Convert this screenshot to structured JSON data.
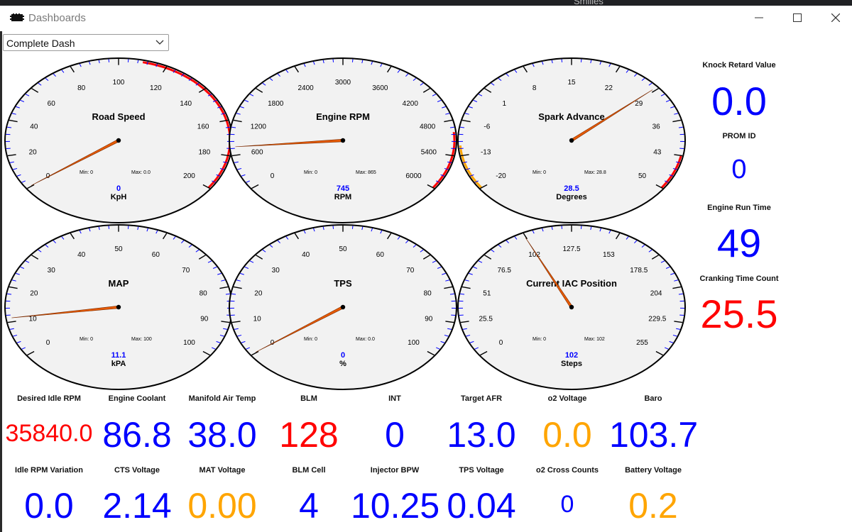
{
  "window": {
    "title": "Dashboards",
    "background_tab_text": "Smilies"
  },
  "dashboard_select": {
    "value": "Complete Dash"
  },
  "colors": {
    "blue": "#0000ff",
    "red": "#ff0000",
    "orange": "#ffa500",
    "needle": "#e65a00",
    "face": "#f2f2f2",
    "warning": "#ff0000",
    "caution": "#ffa500"
  },
  "gauges": [
    {
      "title": "Road Speed",
      "unit": "KpH",
      "value": 0,
      "value_text": "0",
      "min_label": "Min: 0",
      "max_label": "Max: 0.0",
      "range": [
        0,
        200
      ],
      "ticks": [
        "0",
        "20",
        "40",
        "60",
        "80",
        "100",
        "120",
        "140",
        "160",
        "180",
        "200"
      ],
      "red_from": 110,
      "caution": null
    },
    {
      "title": "Engine RPM",
      "unit": "RPM",
      "value": 745,
      "value_text": "745",
      "min_label": "Min: 0",
      "max_label": "Max: 865",
      "range": [
        0,
        6000
      ],
      "ticks": [
        "0",
        "600",
        "1200",
        "1800",
        "2400",
        "3000",
        "3600",
        "4200",
        "4800",
        "5400",
        "6000"
      ],
      "red_from": 5000,
      "caution": null
    },
    {
      "title": "Spark Advance",
      "unit": "Degrees",
      "value": 28.5,
      "value_text": "28.5",
      "min_label": "Min: 0",
      "max_label": "Max: 28.8",
      "range": [
        -20,
        50
      ],
      "ticks": [
        "-20",
        "-13",
        "-6",
        "1",
        "8",
        "15",
        "22",
        "29",
        "36",
        "43",
        "50"
      ],
      "red_from": 43,
      "caution": [
        -20,
        -11
      ]
    },
    {
      "title": "MAP",
      "unit": "kPA",
      "value": 11.1,
      "value_text": "11.1",
      "min_label": "Min: 0",
      "max_label": "Max: 100",
      "range": [
        0,
        100
      ],
      "ticks": [
        "0",
        "10",
        "20",
        "30",
        "40",
        "50",
        "60",
        "70",
        "80",
        "90",
        "100"
      ],
      "red_from": null,
      "caution": null
    },
    {
      "title": "TPS",
      "unit": "%",
      "value": 0,
      "value_text": "0",
      "min_label": "Min: 0",
      "max_label": "Max: 0.0",
      "range": [
        0,
        100
      ],
      "ticks": [
        "0",
        "10",
        "20",
        "30",
        "40",
        "50",
        "60",
        "70",
        "80",
        "90",
        "100"
      ],
      "red_from": null,
      "caution": null
    },
    {
      "title": "Current IAC Position",
      "unit": "Steps",
      "value": 102,
      "value_text": "102",
      "min_label": "Min: 0",
      "max_label": "Max: 102",
      "range": [
        0,
        255
      ],
      "ticks": [
        "0",
        "25.5",
        "51",
        "76.5",
        "102",
        "127.5",
        "153",
        "178.5",
        "204",
        "229.5",
        "255"
      ],
      "red_from": null,
      "caution": null
    }
  ],
  "side_readouts": [
    {
      "label": "Knock Retard Value",
      "value": "0.0",
      "color": "#0000ff"
    },
    {
      "label": "PROM ID",
      "value": "0",
      "color": "#0000ff"
    },
    {
      "label": "Engine Run Time",
      "value": "49",
      "color": "#0000ff"
    },
    {
      "label": "Cranking Time Count",
      "value": "25.5",
      "color": "#ff0000"
    }
  ],
  "readouts_row1": [
    {
      "label": "Desired Idle RPM",
      "value": "35840.0",
      "color": "#ff0000"
    },
    {
      "label": "Engine Coolant",
      "value": "86.8",
      "color": "#0000ff"
    },
    {
      "label": "Manifold Air Temp",
      "value": "38.0",
      "color": "#0000ff"
    },
    {
      "label": "BLM",
      "value": "128",
      "color": "#ff0000"
    },
    {
      "label": "INT",
      "value": "0",
      "color": "#0000ff"
    },
    {
      "label": "Target AFR",
      "value": "13.0",
      "color": "#0000ff"
    },
    {
      "label": "o2 Voltage",
      "value": "0.0",
      "color": "#ffa500"
    },
    {
      "label": "Baro",
      "value": "103.7",
      "color": "#0000ff"
    }
  ],
  "readouts_row2": [
    {
      "label": "Idle RPM Variation",
      "value": "0.0",
      "color": "#0000ff"
    },
    {
      "label": "CTS Voltage",
      "value": "2.14",
      "color": "#0000ff"
    },
    {
      "label": "MAT Voltage",
      "value": "0.00",
      "color": "#ffa500"
    },
    {
      "label": "BLM Cell",
      "value": "4",
      "color": "#0000ff"
    },
    {
      "label": "Injector BPW",
      "value": "10.25",
      "color": "#0000ff"
    },
    {
      "label": "TPS Voltage",
      "value": "0.04",
      "color": "#0000ff"
    },
    {
      "label": "o2 Cross Counts",
      "value": "0",
      "color": "#0000ff"
    },
    {
      "label": "Battery Voltage",
      "value": "0.2",
      "color": "#ffa500"
    }
  ]
}
